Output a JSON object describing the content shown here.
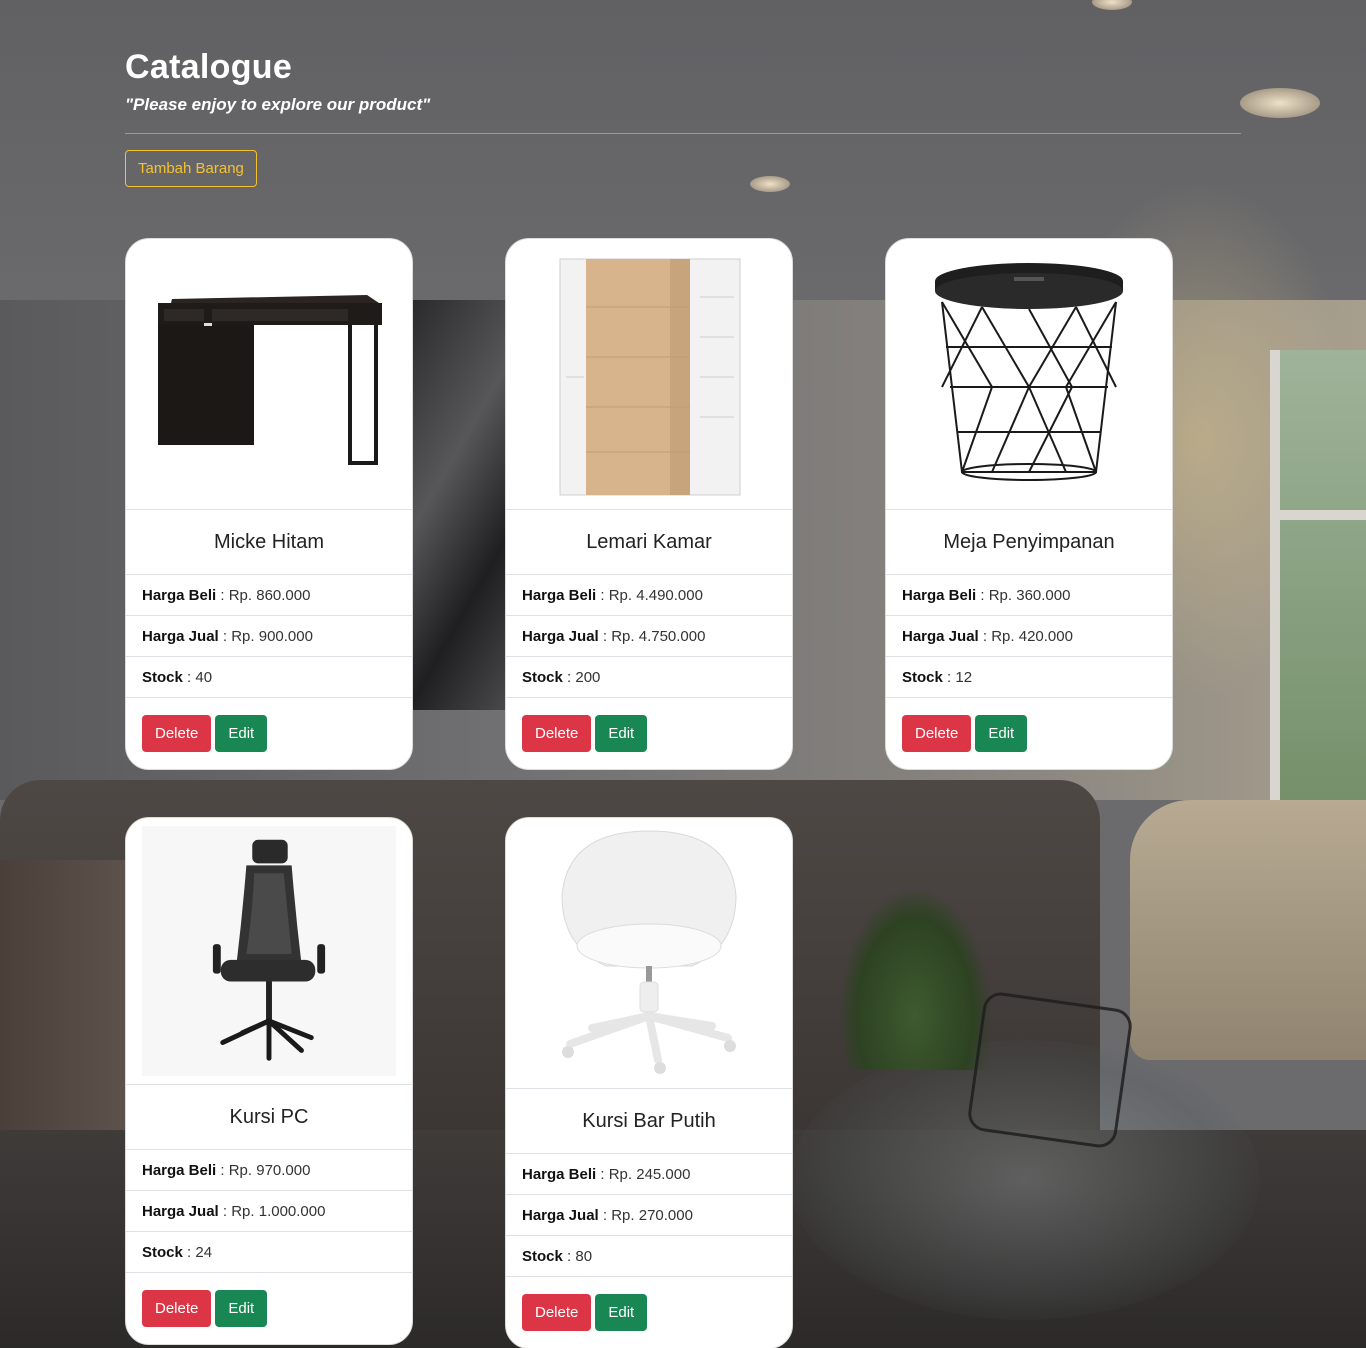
{
  "header": {
    "title": "Catalogue",
    "subtitle": "\"Please enjoy to explore our product\"",
    "add_button": "Tambah Barang"
  },
  "labels": {
    "buy": "Harga Beli",
    "sell": "Harga Jual",
    "stock": "Stock",
    "delete": "Delete",
    "edit": "Edit"
  },
  "products": [
    {
      "name": "Micke Hitam",
      "buy": "Rp. 860.000",
      "sell": "Rp. 900.000",
      "stock": "40",
      "image": "black-desk-image"
    },
    {
      "name": "Lemari Kamar",
      "buy": "Rp. 4.490.000",
      "sell": "Rp. 4.750.000",
      "stock": "200",
      "image": "wardrobe-image"
    },
    {
      "name": "Meja Penyimpanan",
      "buy": "Rp. 360.000",
      "sell": "Rp. 420.000",
      "stock": "12",
      "image": "wire-storage-table-image"
    },
    {
      "name": "Kursi PC",
      "buy": "Rp. 970.000",
      "sell": "Rp. 1.000.000",
      "stock": "24",
      "image": "office-chair-image"
    },
    {
      "name": "Kursi Bar Putih",
      "buy": "Rp. 245.000",
      "sell": "Rp. 270.000",
      "stock": "80",
      "image": "white-swivel-chair-image"
    }
  ],
  "colors": {
    "accent_outline": "#f5c22e",
    "delete": "#dc3545",
    "edit": "#198754"
  }
}
